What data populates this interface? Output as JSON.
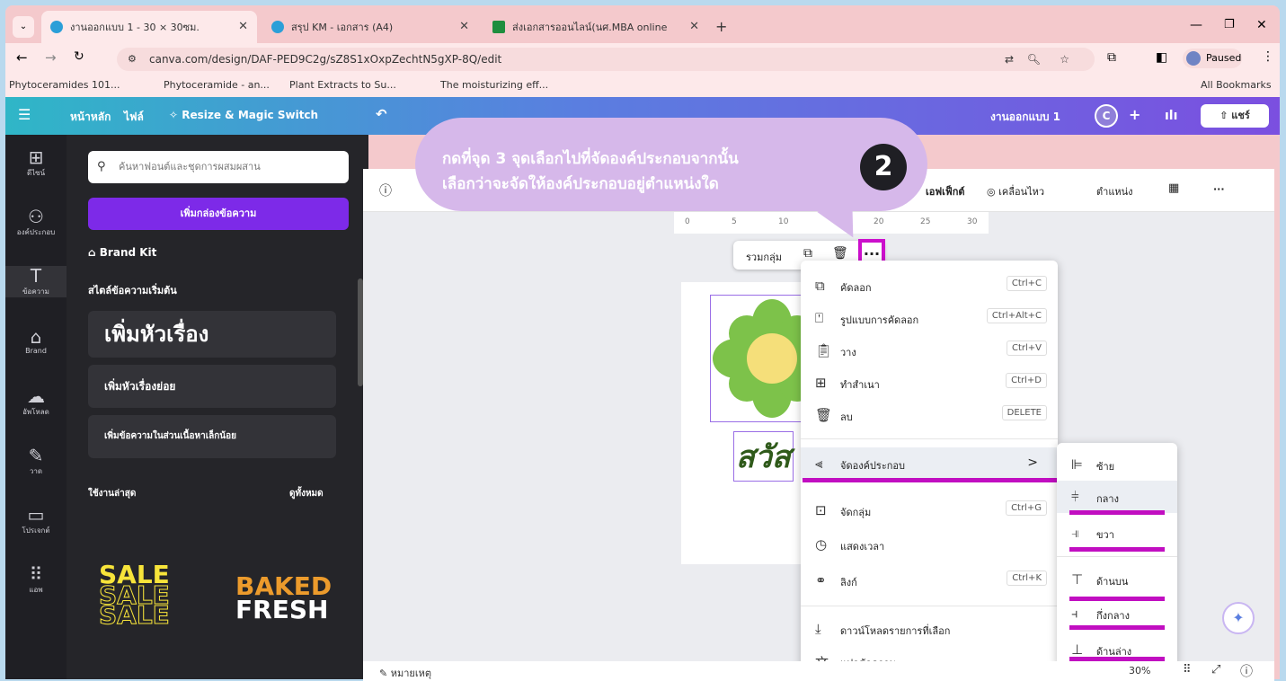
{
  "browser": {
    "tabs": [
      {
        "label": "งานออกแบบ 1 - 30 × 30ซม.",
        "active": true
      },
      {
        "label": "สรุป KM - เอกสาร (A4)",
        "active": false
      },
      {
        "label": "ส่งเอกสารออนไลน์(นศ.MBA online",
        "active": false
      }
    ],
    "new_tab": "+",
    "url": "canva.com/design/DAF-PED9C2g/sZ8S1xOxpZechtN5gXP-8Q/edit",
    "profile_status": "Paused",
    "bookmarks": [
      "Phytoceramides 101...",
      "Phytoceramide - an...",
      "Plant Extracts to Su...",
      "The moisturizing eff..."
    ],
    "all_bookmarks": "All Bookmarks"
  },
  "canva_header": {
    "home": "หน้าหลัก",
    "file": "ไฟล์",
    "resize": "Resize & Magic Switch",
    "doc_name": "งานออกแบบ 1",
    "avatar": "C",
    "share": "แชร์"
  },
  "rail": [
    "ดีไซน์",
    "องค์ประกอบ",
    "ข้อความ",
    "Brand",
    "อัพโหลด",
    "วาด",
    "โปรเจกต์",
    "แอพ"
  ],
  "panel": {
    "search_placeholder": "ค้นหาฟอนต์และชุดการผสมผสาน",
    "add_textbox": "เพิ่มกล่องข้อความ",
    "brand_kit": "Brand Kit",
    "default_styles": "สไตล์ข้อความเริ่มต้น",
    "heading": "เพิ่มหัวเรื่อง",
    "subheading": "เพิ่มหัวเรื่องย่อย",
    "body": "เพิ่มข้อความในส่วนเนื้อหาเล็กน้อย",
    "recent": "ใช้งานล่าสุด",
    "see_all": "ดูทั้งหมด",
    "thumb1": "SALE",
    "thumb2a": "BAKED",
    "thumb2b": "FRESH"
  },
  "toolbar": {
    "effects": "เอฟเฟ็กต์",
    "animate": "เคลื่อนไหว",
    "position": "ตำแหน่ง",
    "more": "···"
  },
  "ruler": [
    "0",
    "5",
    "10",
    "20",
    "25",
    "30"
  ],
  "floatbar": {
    "group": "รวมกลุ่ม",
    "more": "···"
  },
  "canvas_text": "สวัส",
  "callout": {
    "line1": "กดที่จุด 3 จุดเลือกไปที่จัดองค์ประกอบจากนั้น",
    "line2": "เลือกว่าจะจัดให้องค์ประกอบอยู่ตำแหน่งใด",
    "badge": "2"
  },
  "context_menu": [
    {
      "label": "คัดลอก",
      "shortcut": "Ctrl+C",
      "icon": "copy-icon"
    },
    {
      "label": "รูปแบบการคัดลอก",
      "shortcut": "Ctrl+Alt+C",
      "icon": "paint-roller-icon"
    },
    {
      "label": "วาง",
      "shortcut": "Ctrl+V",
      "icon": "clipboard-icon"
    },
    {
      "label": "ทำสำเนา",
      "shortcut": "Ctrl+D",
      "icon": "duplicate-icon"
    },
    {
      "label": "ลบ",
      "shortcut": "DELETE",
      "icon": "trash-icon"
    },
    {
      "label": "จัดองค์ประกอบ",
      "shortcut": ">",
      "icon": "align-icon"
    },
    {
      "label": "จัดกลุ่ม",
      "shortcut": "Ctrl+G",
      "icon": "group-icon"
    },
    {
      "label": "แสดงเวลา",
      "shortcut": "",
      "icon": "clock-icon"
    },
    {
      "label": "ลิงก์",
      "shortcut": "Ctrl+K",
      "icon": "link-icon"
    },
    {
      "label": "ดาวน์โหลดรายการที่เลือก",
      "shortcut": "",
      "icon": "download-icon"
    },
    {
      "label": "แปลข้อความ",
      "shortcut": "",
      "icon": "translate-icon"
    }
  ],
  "align_submenu": [
    "ซ้าย",
    "กลาง",
    "ขวา",
    "ด้านบน",
    "กึ่งกลาง",
    "ด้านล่าง"
  ],
  "status": {
    "notes": "หมายเหตุ",
    "zoom": "30%"
  },
  "colors": {
    "accent": "#7d2ae8",
    "highlight": "#c10ec1",
    "callout": "#d6b8ea"
  }
}
